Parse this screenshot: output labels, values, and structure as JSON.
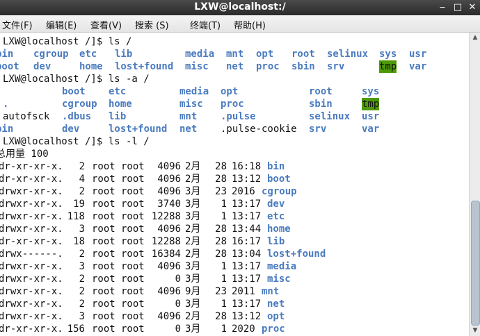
{
  "window": {
    "title": "LXW@localhost:/"
  },
  "menu": [
    "文件(F)",
    "编辑(E)",
    "查看(V)",
    "搜索 (S)",
    "终端(T)",
    "帮助(H)"
  ],
  "terminal": {
    "prompt1": "LXW@localhost /]$ ls /",
    "ls_row1": [
      "bin",
      "cgroup",
      "etc",
      "lib",
      "media",
      "mnt",
      "opt",
      "root",
      "selinux",
      "sys",
      "usr"
    ],
    "ls_row2": [
      "boot",
      "dev",
      "home",
      "lost+found",
      "misc",
      "net",
      "proc",
      "sbin",
      "srv",
      "tmp",
      "var"
    ],
    "prompt2": "LXW@localhost /]$ ls -a /",
    "la_row1": [
      "boot",
      "etc",
      "media",
      "opt",
      "root",
      "sys"
    ],
    "la_row2": [
      ".",
      "cgroup",
      "home",
      "misc",
      "proc",
      "sbin",
      "tmp"
    ],
    "la_row3": [
      "autofsck",
      ".dbus",
      "lib",
      "mnt",
      ".pulse",
      "selinux",
      "usr"
    ],
    "la_row4": [
      "bin",
      "dev",
      "lost+found",
      "net",
      ".pulse-cookie",
      "srv",
      "var"
    ],
    "prompt3": "LXW@localhost /]$ ls -l /",
    "total": "总用量 100",
    "long": [
      {
        "perm": "dr-xr-xr-x.",
        "links": "2",
        "user": "root",
        "group": "root",
        "size": "4096",
        "month": "2月",
        "day": "28",
        "time": "16:18",
        "name": "bin"
      },
      {
        "perm": "dr-xr-xr-x.",
        "links": "4",
        "user": "root",
        "group": "root",
        "size": "4096",
        "month": "2月",
        "day": "28",
        "time": "13:12",
        "name": "boot"
      },
      {
        "perm": "drwxr-xr-x.",
        "links": "2",
        "user": "root",
        "group": "root",
        "size": "4096",
        "month": "3月",
        "day": "23",
        "time": "2016",
        "name": "cgroup"
      },
      {
        "perm": "drwxr-xr-x.",
        "links": "19",
        "user": "root",
        "group": "root",
        "size": "3740",
        "month": "3月",
        "day": "1",
        "time": "13:17",
        "name": "dev"
      },
      {
        "perm": "drwxr-xr-x.",
        "links": "118",
        "user": "root",
        "group": "root",
        "size": "12288",
        "month": "3月",
        "day": "1",
        "time": "13:17",
        "name": "etc"
      },
      {
        "perm": "drwxr-xr-x.",
        "links": "3",
        "user": "root",
        "group": "root",
        "size": "4096",
        "month": "2月",
        "day": "28",
        "time": "13:44",
        "name": "home"
      },
      {
        "perm": "dr-xr-xr-x.",
        "links": "18",
        "user": "root",
        "group": "root",
        "size": "12288",
        "month": "2月",
        "day": "28",
        "time": "16:17",
        "name": "lib"
      },
      {
        "perm": "drwx------.",
        "links": "2",
        "user": "root",
        "group": "root",
        "size": "16384",
        "month": "2月",
        "day": "28",
        "time": "13:04",
        "name": "lost+found"
      },
      {
        "perm": "drwxr-xr-x.",
        "links": "3",
        "user": "root",
        "group": "root",
        "size": "4096",
        "month": "3月",
        "day": "1",
        "time": "13:17",
        "name": "media"
      },
      {
        "perm": "drwxr-xr-x.",
        "links": "2",
        "user": "root",
        "group": "root",
        "size": "0",
        "month": "3月",
        "day": "1",
        "time": "13:17",
        "name": "misc"
      },
      {
        "perm": "drwxr-xr-x.",
        "links": "2",
        "user": "root",
        "group": "root",
        "size": "4096",
        "month": "9月",
        "day": "23",
        "time": "2011",
        "name": "mnt"
      },
      {
        "perm": "drwxr-xr-x.",
        "links": "2",
        "user": "root",
        "group": "root",
        "size": "0",
        "month": "3月",
        "day": "1",
        "time": "13:17",
        "name": "net"
      },
      {
        "perm": "drwxr-xr-x.",
        "links": "3",
        "user": "root",
        "group": "root",
        "size": "4096",
        "month": "2月",
        "day": "28",
        "time": "13:12",
        "name": "opt"
      },
      {
        "perm": "dr-xr-xr-x.",
        "links": "156",
        "user": "root",
        "group": "root",
        "size": "0",
        "month": "3月",
        "day": "1",
        "time": "2020",
        "name": "proc"
      }
    ]
  },
  "colors": {
    "directory": "#4a7bbf",
    "highlight_bg": "#4e9a06",
    "text": "#111111"
  },
  "icons": {
    "minimize": "minimize-icon",
    "maximize": "maximize-icon",
    "close": "close-icon"
  }
}
